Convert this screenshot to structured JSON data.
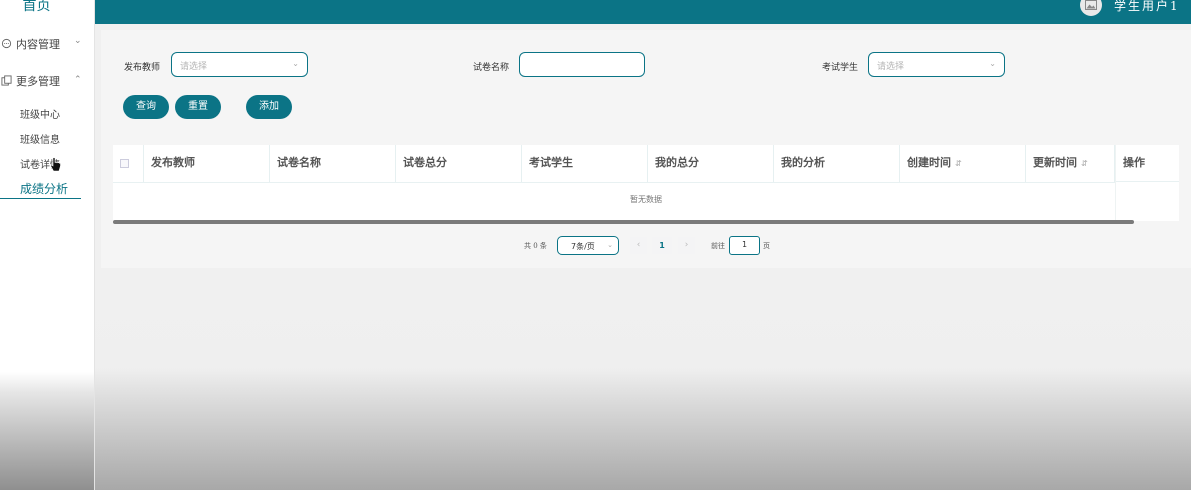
{
  "sidebar": {
    "home": "首页",
    "groups": [
      {
        "label": "内容管理",
        "icon": "chat-bubble-icon",
        "expanded": false
      },
      {
        "label": "更多管理",
        "icon": "copy-icon",
        "expanded": true
      }
    ],
    "sub_items": [
      "班级中心",
      "班级信息",
      "试卷详情",
      "成绩分析"
    ],
    "active_item": "成绩分析"
  },
  "topbar": {
    "user_name": "学生用户1",
    "avatar_icon": "image-icon",
    "color": "#0b7486"
  },
  "filters": {
    "teacher_label": "发布教师",
    "teacher_placeholder": "请选择",
    "paper_label": "试卷名称",
    "paper_value": "",
    "student_label": "考试学生",
    "student_placeholder": "请选择"
  },
  "buttons": {
    "query": "查询",
    "reset": "重置",
    "add": "添加"
  },
  "table": {
    "columns": [
      "发布教师",
      "试卷名称",
      "试卷总分",
      "考试学生",
      "我的总分",
      "我的分析",
      "创建时间",
      "更新时间",
      "操作"
    ],
    "empty_text": "暂无数据",
    "rows": []
  },
  "pagination": {
    "total_text": "共 0 条",
    "page_size": "7条/页",
    "prev": "‹",
    "current_page": "1",
    "next": "›",
    "goto_label": "前往",
    "goto_value": "1",
    "page_suffix": "页"
  }
}
